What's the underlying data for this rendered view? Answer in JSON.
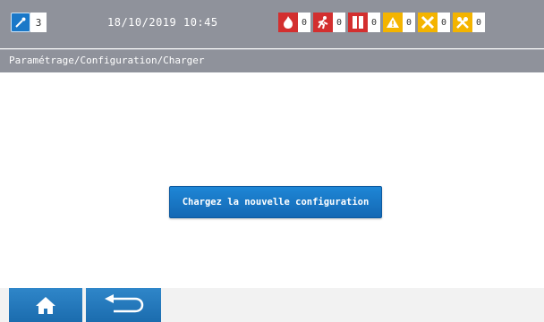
{
  "header": {
    "mode_count": "3",
    "datetime": "18/10/2019 10:45",
    "indicators": [
      {
        "icon": "fire-icon",
        "color": "#d32f2f",
        "count": "0"
      },
      {
        "icon": "evacuation-runner-icon",
        "color": "#d32f2f",
        "count": "0"
      },
      {
        "icon": "fire-door-icon",
        "color": "#d32f2f",
        "count": "0"
      },
      {
        "icon": "warning-triangle-icon",
        "color": "#f4b400",
        "count": "0"
      },
      {
        "icon": "fault-cross-icon",
        "color": "#f4b400",
        "count": "0"
      },
      {
        "icon": "maintenance-tools-icon",
        "color": "#f4b400",
        "count": "0"
      }
    ]
  },
  "breadcrumb": "Paramétrage/Configuration/Charger",
  "main": {
    "load_button_label": "Chargez la nouvelle configuration"
  },
  "colors": {
    "header_bg": "#8f929b",
    "accent": "#1a78c8",
    "alarm_red": "#d32f2f",
    "fault_yellow": "#f4b400"
  }
}
